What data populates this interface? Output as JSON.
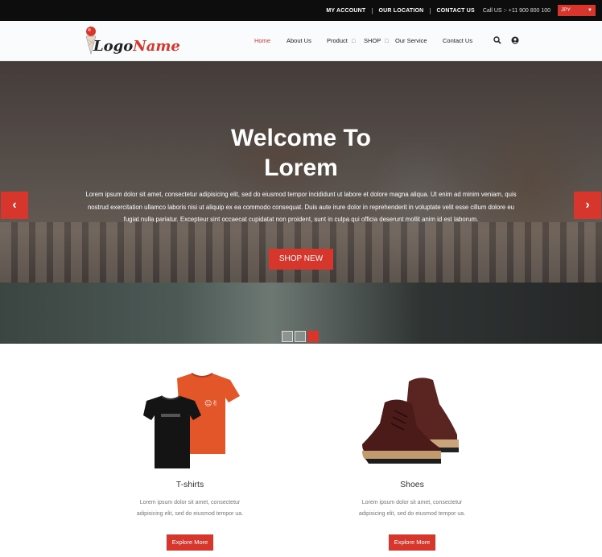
{
  "topbar": {
    "links": [
      "MY ACCOUNT",
      "OUR LOCATION",
      "CONTACT US"
    ],
    "phone": "Call US :- +11 900 800 100",
    "currency": "JPY"
  },
  "header": {
    "logo_text_1": "Logo",
    "logo_text_2": "Name",
    "nav": {
      "home": "Home",
      "about": "About Us",
      "product": "Product",
      "shop": "SHOP",
      "service": "Our Service",
      "contact": "Contact Us"
    }
  },
  "hero": {
    "title_line1": "Welcome To",
    "title_line2": "Lorem",
    "description": "Lorem ipsum dolor sit amet, consectetur adipisicing elit, sed do eiusmod tempor incididunt ut labore et dolore magna aliqua. Ut enim ad minim veniam, quis nostrud exercitation ullamco laboris nisi ut aliquip ex ea commodo consequat. Duis aute irure dolor in reprehenderit in voluptate velit esse cillum dolore eu fugiat nulla pariatur. Excepteur sint occaecat cupidatat non proident, sunt in culpa qui officia deserunt mollit anim id est laborum.",
    "button": "SHOP NEW",
    "prev": "‹",
    "next": "›"
  },
  "products": [
    {
      "title": "T-shirts",
      "text": "Lorem ipsum dolor sit amet, consectetur adipisicing elit, sed do eiusmod tempor ua.",
      "button": "Explore More"
    },
    {
      "title": "Shoes",
      "text": "Lorem ipsum dolor sit amet, consectetur adipisicing elit, sed do eiusmod tempor ua.",
      "button": "Explore More"
    }
  ],
  "colors": {
    "accent": "#d7362c",
    "topbar": "#0d0d0d"
  }
}
